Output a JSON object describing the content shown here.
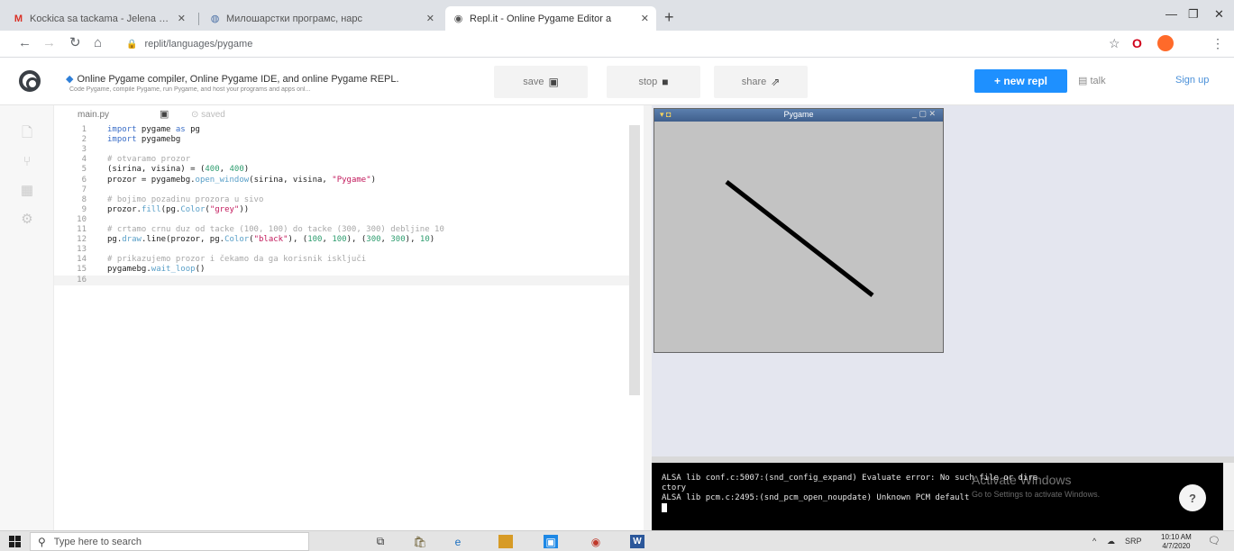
{
  "browser": {
    "tabs": [
      {
        "title": "Kockica sa tackama - Jelena Zar",
        "favicon": "gmail-icon",
        "active": false
      },
      {
        "title": "Милошарстки програмс, нарс",
        "favicon": "web-icon",
        "active": false
      },
      {
        "title": "Repl.it - Online Pygame Editor a",
        "favicon": "replit-icon",
        "active": true
      }
    ],
    "new_tab": "+",
    "window_controls": {
      "minimize": "—",
      "maximize": "❐",
      "close": "✕"
    },
    "url": "replit/languages/pygame"
  },
  "replit": {
    "title": "Online Pygame compiler, Online Pygame IDE, and online Pygame REPL.",
    "subtitle": "Code Pygame, compile Pygame, run Pygame, and host your programs and apps onl...",
    "buttons": {
      "save": "save",
      "stop": "stop",
      "share": "share"
    },
    "new_repl": "+ new repl",
    "talk": "talk",
    "sign_up": "Sign up"
  },
  "editor": {
    "filename": "main.py",
    "saved": "saved",
    "lines": [
      {
        "n": "1",
        "text": "import pygame as pg"
      },
      {
        "n": "2",
        "text": "import pygamebg"
      },
      {
        "n": "3",
        "text": ""
      },
      {
        "n": "4",
        "text": "# otvaramo prozor"
      },
      {
        "n": "5",
        "text": "(sirina, visina) = (400, 400)"
      },
      {
        "n": "6",
        "text": "prozor = pygamebg.open_window(sirina, visina, \"Pygame\")"
      },
      {
        "n": "7",
        "text": ""
      },
      {
        "n": "8",
        "text": "# bojimo pozadinu prozora u sivo"
      },
      {
        "n": "9",
        "text": "prozor.fill(pg.Color(\"grey\"))"
      },
      {
        "n": "10",
        "text": ""
      },
      {
        "n": "11",
        "text": "# crtamo crnu duz od tacke (100, 100) do tacke (300, 300) debljine 10"
      },
      {
        "n": "12",
        "text": "pg.draw.line(prozor, pg.Color(\"black\"), (100, 100), (300, 300), 10)"
      },
      {
        "n": "13",
        "text": ""
      },
      {
        "n": "14",
        "text": "# prikazujemo prozor i čekamo da ga korisnik isključi"
      },
      {
        "n": "15",
        "text": "pygamebg.wait_loop()"
      },
      {
        "n": "16",
        "text": ""
      }
    ]
  },
  "pygame_window": {
    "title": "Pygame",
    "background": "#c3c3c3",
    "line_color": "#000000"
  },
  "console": {
    "lines": [
      "ALSA lib conf.c:5007:(snd_config_expand) Evaluate error: No such file or dire",
      "ctory",
      "ALSA lib pcm.c:2495:(snd_pcm_open_noupdate) Unknown PCM default"
    ],
    "watermark": "Activate Windows",
    "watermark_sub": "Go to Settings to activate Windows."
  },
  "taskbar": {
    "search_placeholder": "Type here to search",
    "lang": "SRP",
    "time": "10:10 AM",
    "date": "4/7/2020"
  },
  "colors": {
    "accent": "#1e90ff",
    "console_bg": "#000000",
    "output_bg": "#e4e6ef"
  }
}
